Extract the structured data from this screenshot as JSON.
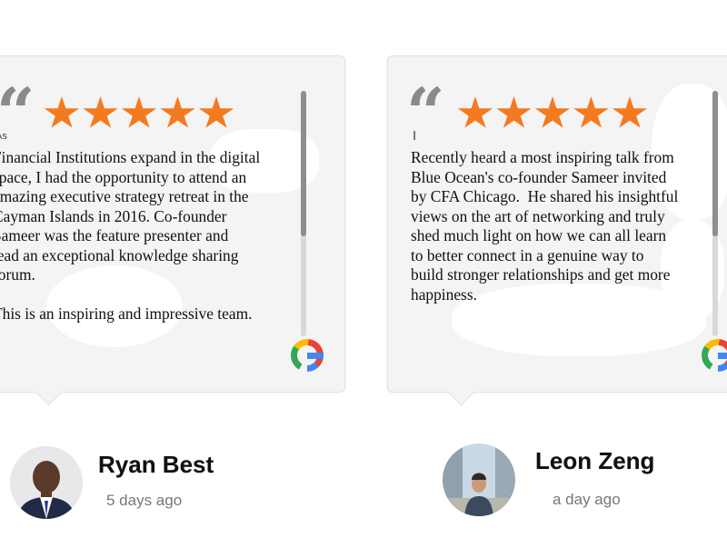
{
  "reviews": [
    {
      "rating": 5,
      "prefix": "As",
      "text": "Financial Institutions expand in the digital\nspace, I had the opportunity to attend an\namazing executive strategy retreat in the\nCayman Islands in 2016. Co-founder\nSameer was the feature presenter and\nlead an exceptional knowledge sharing\nforum.\n\nThis is an inspiring and impressive team.",
      "source_icon": "google-icon",
      "reviewer_name": "Ryan Best",
      "time_ago": "5 days ago"
    },
    {
      "rating": 5,
      "prefix": "I",
      "text": "Recently heard a most inspiring talk from\nBlue Ocean's co-founder Sameer invited\nby CFA Chicago.  He shared his insightful\nviews on the art of networking and truly\nshed much light on how we can all learn\nto better connect in a genuine way to\nbuild stronger relationships and get more\nhappiness.",
      "source_icon": "google-icon",
      "reviewer_name": "Leon Zeng",
      "time_ago": "a day ago"
    }
  ],
  "colors": {
    "star": "#f47a20",
    "card_bg": "#f4f4f4",
    "quote": "#8a8a8a",
    "name": "#111111",
    "time": "#777777"
  }
}
